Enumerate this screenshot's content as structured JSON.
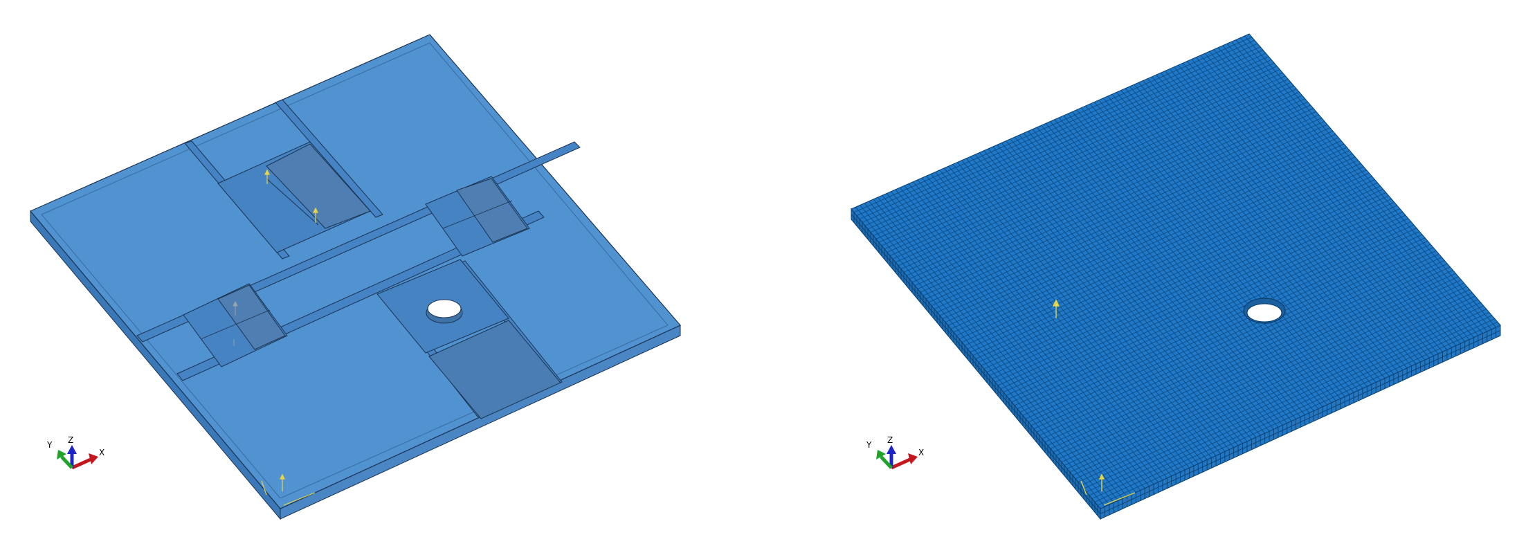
{
  "left_view": {
    "triad": {
      "x_label": "X",
      "y_label": "Y",
      "z_label": "Z"
    }
  },
  "right_view": {
    "triad": {
      "x_label": "X",
      "y_label": "Y",
      "z_label": "Z"
    }
  },
  "colors": {
    "background": "#ffffff",
    "part_face": "#5192d1",
    "part_face_dark": "#3f7ab8",
    "part_side": "#3a78b8",
    "mesh_face": "#1f78c8",
    "mesh_line": "#0b3f6e",
    "edge": "#1b3350",
    "constraint_marker": "#e6d44a",
    "axis_x": "#c4161c",
    "axis_y": "#21a32a",
    "axis_z": "#1c24c8"
  }
}
